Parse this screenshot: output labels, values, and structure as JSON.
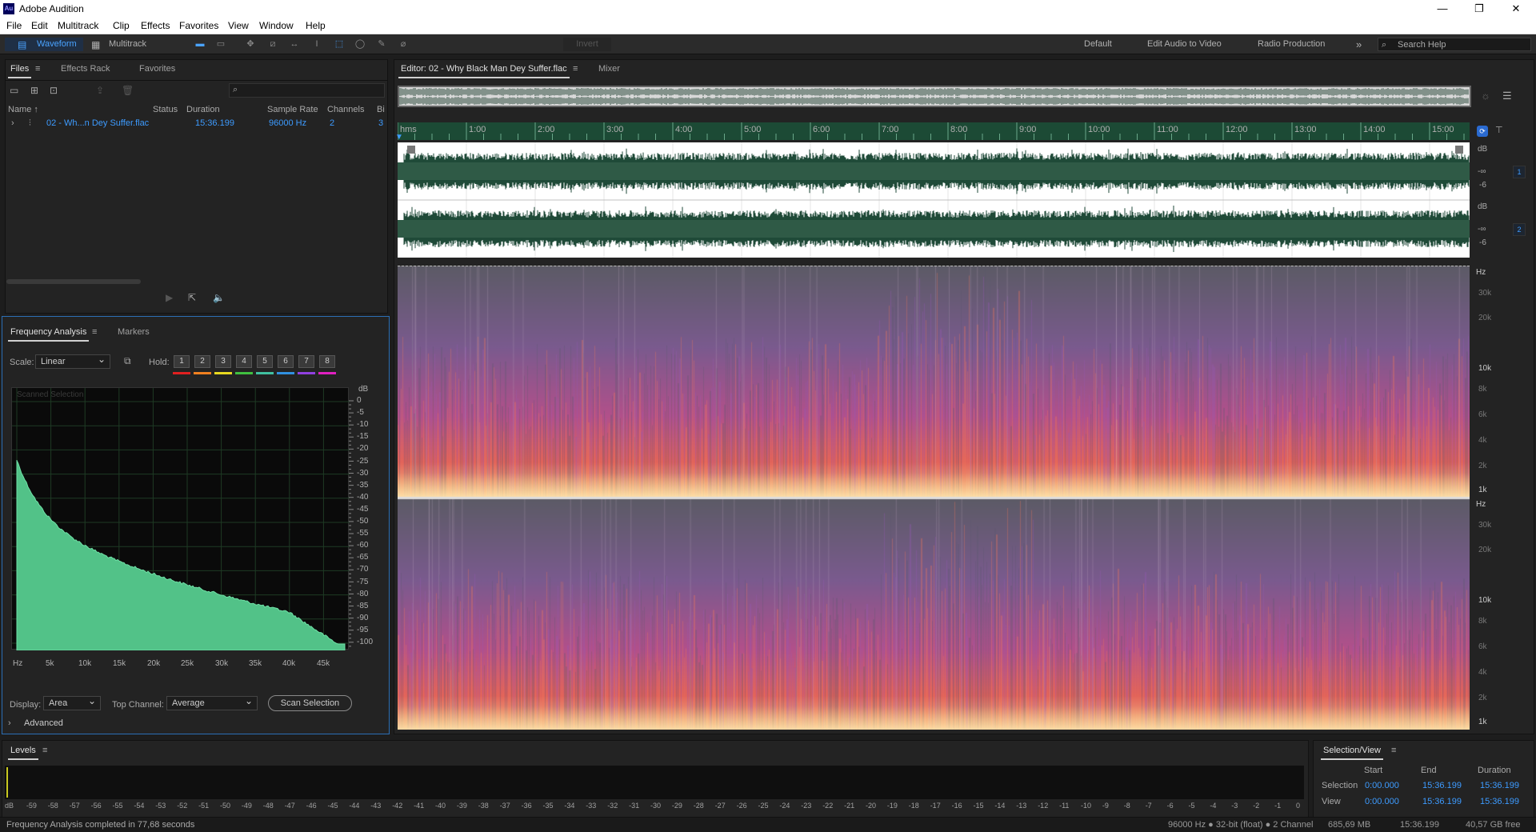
{
  "app": {
    "title": "Adobe Audition",
    "logo": "Au"
  },
  "menu": [
    "File",
    "Edit",
    "Multitrack",
    "Clip",
    "Effects",
    "Favorites",
    "View",
    "Window",
    "Help"
  ],
  "toolbar": {
    "waveform": "Waveform",
    "multitrack": "Multitrack",
    "invert": "Invert",
    "workspaces": [
      "Default",
      "Edit Audio to Video",
      "Radio Production"
    ],
    "more": "»",
    "search_placeholder": "Search Help"
  },
  "files_panel": {
    "tabs": [
      "Files",
      "Effects Rack",
      "Favorites"
    ],
    "columns": [
      "Name ↑",
      "Status",
      "Duration",
      "Sample Rate",
      "Channels",
      "Bi"
    ],
    "file": {
      "name": "02 - Wh...n Dey Suffer.flac",
      "duration": "15:36.199",
      "sample_rate": "96000 Hz",
      "channels": "2",
      "bit": "3"
    }
  },
  "freq_panel": {
    "tabs": [
      "Frequency Analysis",
      "Markers"
    ],
    "scale_label": "Scale:",
    "scale_value": "Linear",
    "hold_label": "Hold:",
    "hold_buttons": [
      "1",
      "2",
      "3",
      "4",
      "5",
      "6",
      "7",
      "8"
    ],
    "hold_colors": [
      "#e02020",
      "#f08020",
      "#e8d820",
      "#40c040",
      "#40c0a0",
      "#3090e0",
      "#9040e0",
      "#e020c0"
    ],
    "graph_label": "Scanned Selection",
    "db_unit": "dB",
    "db_ticks": [
      "0",
      "-5",
      "-10",
      "-15",
      "-20",
      "-25",
      "-30",
      "-35",
      "-40",
      "-45",
      "-50",
      "-55",
      "-60",
      "-65",
      "-70",
      "-75",
      "-80",
      "-85",
      "-90",
      "-95",
      "-100"
    ],
    "hz_ticks": [
      "Hz",
      "5k",
      "10k",
      "15k",
      "20k",
      "25k",
      "30k",
      "35k",
      "40k",
      "45k"
    ],
    "display_label": "Display:",
    "display_value": "Area",
    "top_channel_label": "Top Channel:",
    "top_channel_value": "Average",
    "scan_button": "Scan Selection",
    "advanced": "Advanced"
  },
  "editor": {
    "tab": "Editor: 02 - Why Black Man Dey Suffer.flac",
    "mixer": "Mixer",
    "ruler": [
      "hms",
      "1:00",
      "2:00",
      "3:00",
      "4:00",
      "5:00",
      "6:00",
      "7:00",
      "8:00",
      "9:00",
      "10:00",
      "11:00",
      "12:00",
      "13:00",
      "14:00",
      "15:00"
    ],
    "channel_db": [
      "dB",
      "-∞",
      "-6"
    ],
    "channels": [
      "1",
      "2"
    ],
    "spectral_hz": [
      "Hz",
      "30k",
      "20k",
      "10k",
      "8k",
      "6k",
      "4k",
      "2k",
      "1k"
    ]
  },
  "levels": {
    "title": "Levels",
    "ticks": [
      "dB",
      "-59",
      "-58",
      "-57",
      "-56",
      "-55",
      "-54",
      "-53",
      "-52",
      "-51",
      "-50",
      "-49",
      "-48",
      "-47",
      "-46",
      "-45",
      "-44",
      "-43",
      "-42",
      "-41",
      "-40",
      "-39",
      "-38",
      "-37",
      "-36",
      "-35",
      "-34",
      "-33",
      "-32",
      "-31",
      "-30",
      "-29",
      "-28",
      "-27",
      "-26",
      "-25",
      "-24",
      "-23",
      "-22",
      "-21",
      "-20",
      "-19",
      "-18",
      "-17",
      "-16",
      "-15",
      "-14",
      "-13",
      "-12",
      "-11",
      "-10",
      "-9",
      "-8",
      "-7",
      "-6",
      "-5",
      "-4",
      "-3",
      "-2",
      "-1",
      "0"
    ]
  },
  "selection_view": {
    "title": "Selection/View",
    "headers": [
      "Start",
      "End",
      "Duration"
    ],
    "rows": [
      {
        "label": "Selection",
        "start": "0:00.000",
        "end": "15:36.199",
        "duration": "15:36.199"
      },
      {
        "label": "View",
        "start": "0:00.000",
        "end": "15:36.199",
        "duration": "15:36.199"
      }
    ]
  },
  "status": {
    "left": "Frequency Analysis completed in 77,68 seconds",
    "format": "96000 Hz ● 32-bit (float) ● 2 Channel",
    "size": "685,69 MB",
    "duration": "15:36.199",
    "free": "40,57 GB free"
  }
}
